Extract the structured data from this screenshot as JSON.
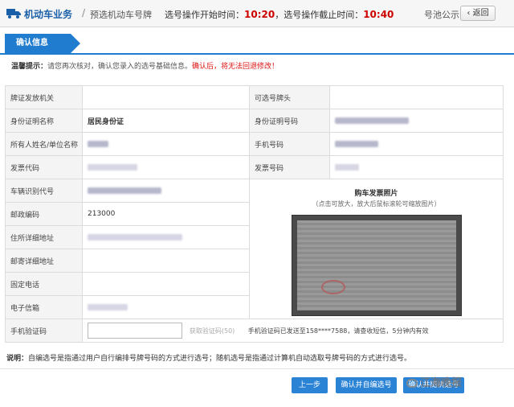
{
  "header": {
    "business": "机动车业务",
    "separator": "/",
    "subtitle": "预选机动车号牌",
    "start_label": "选号操作开始时间：",
    "start_time": "10:20",
    "end_label": "，选号操作截止时间：",
    "end_time": "10:40",
    "notice": "号池公示",
    "back": "返回"
  },
  "step": {
    "label": "确认信息"
  },
  "tip": {
    "prefix": "温馨提示：",
    "text": "请您再次核对，确认您录入的选号基础信息。",
    "warning": "确认后，将无法回退修改！"
  },
  "form": {
    "issuing_office_label": "牌证发放机关",
    "plate_prefix_label": "可选号牌头",
    "id_type_label": "身份证明名称",
    "id_type_value": "居民身份证",
    "id_number_label": "身份证明号码",
    "owner_label": "所有人姓名/单位名称",
    "phone_label": "手机号码",
    "invoice_code_label": "发票代码",
    "invoice_number_label": "发票号码",
    "vin_label": "车辆识别代号",
    "postal_label": "邮政编码",
    "postal_value": "213000",
    "address_label": "住所详细地址",
    "mail_address_label": "邮寄详细地址",
    "landline_label": "固定电话",
    "email_label": "电子信箱",
    "sms_label": "手机验证码",
    "sms_input_value": "",
    "get_code": "获取验证码(50)",
    "sms_sent": "手机验证码已发送至158****7588，请查收短信，5分钟内有效"
  },
  "photo": {
    "title": "购车发票照片",
    "hint": "（点击可放大，放大后鼠标滚轮可缩放图片）"
  },
  "note": {
    "prefix": "说明：",
    "text": "自编选号是指通过用户自行编排号牌号码的方式进行选号；随机选号是指通过计算机自动选取号牌号码的方式进行选号。"
  },
  "buttons": {
    "prev": "上一步",
    "confirm_self": "确认并自编选号",
    "confirm_random": "确认并随机选号"
  },
  "watermark": {
    "text": "江海晚报"
  }
}
